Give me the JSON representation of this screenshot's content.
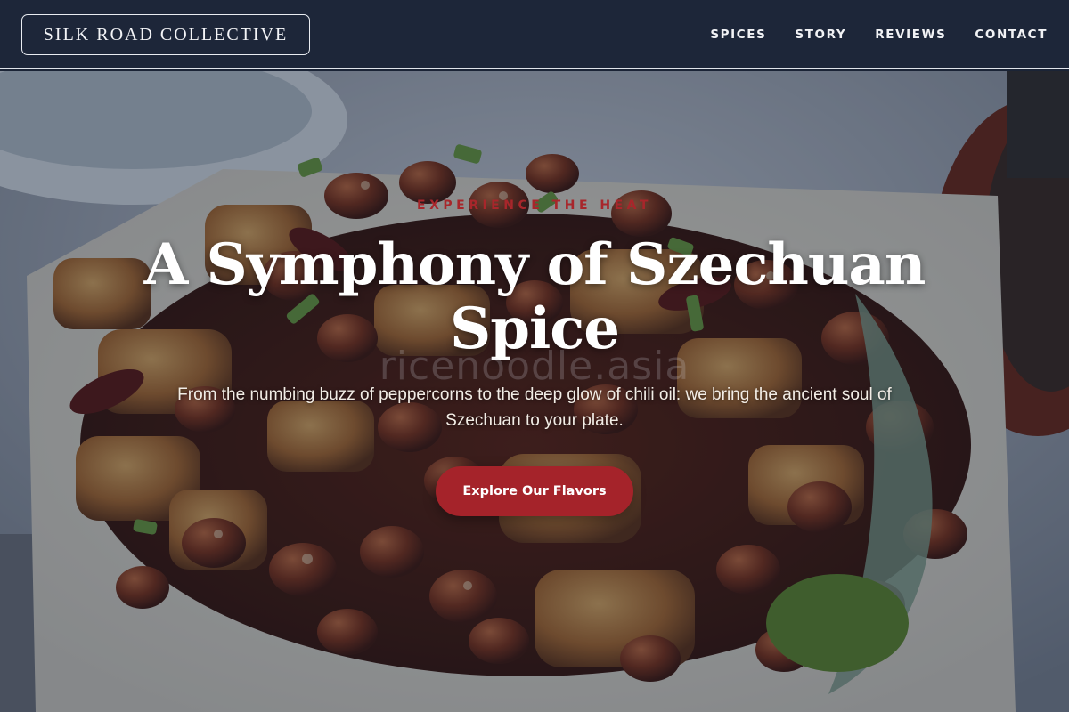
{
  "header": {
    "logo_text": "SILK ROAD COLLECTIVE",
    "nav": [
      {
        "label": "SPICES"
      },
      {
        "label": "STORY"
      },
      {
        "label": "REVIEWS"
      },
      {
        "label": "CONTACT"
      }
    ]
  },
  "hero": {
    "eyebrow": "EXPERIENCE THE HEAT",
    "headline": "A Symphony of Szechuan Spice",
    "watermark": "ricenoodle.asia",
    "subtext": "From the numbing buzz of peppercorns to the deep glow of chili oil: we bring the ancient soul of Szechuan to your plate.",
    "cta_label": "Explore Our Flavors",
    "background_image": "plate-of-kung-pao-chicken-with-peanuts"
  },
  "colors": {
    "header_bg": "#1d2639",
    "accent_red": "#a5232a",
    "text_light": "#ffffff"
  }
}
